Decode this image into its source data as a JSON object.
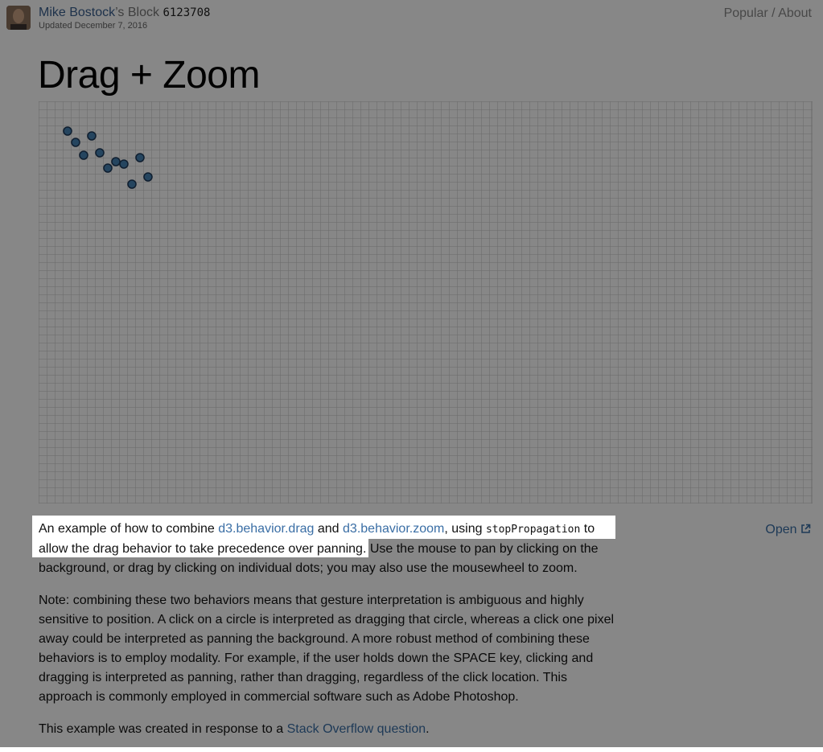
{
  "header": {
    "author": "Mike Bostock",
    "author_suffix": "’s Block",
    "block_id": "6123708",
    "updated": "Updated December 7, 2016",
    "nav": {
      "popular": "Popular",
      "separator": "/",
      "about": "About"
    }
  },
  "title": "Drag + Zoom",
  "open_label": "Open",
  "colors": {
    "dot_fill": "#4682b4",
    "link": "#3a6ea5",
    "overlay": "rgba(0,0,0,0.47)"
  },
  "desc": {
    "p1": {
      "t1": "An example of how to combine ",
      "link1": "d3.behavior.drag",
      "t2": " and ",
      "link2": "d3.behavior.zoom",
      "t3": ", using ",
      "code": "stopPropagation",
      "t4": " to allow the drag behavior to take precedence over panning.",
      "t5": " Use the mouse to pan by clicking on the background, or drag by clicking on individual dots; you may also use the mousewheel to zoom."
    },
    "p2": "Note: combining these two behaviors means that gesture interpretation is ambiguous and highly sensitive to position. A click on a circle is interpreted as dragging that circle, whereas a click one pixel away could be interpreted as panning the background. A more robust method of combining these behaviors is to employ modality. For example, if the user holds down the SPACE key, clicking and dragging is interpreted as panning, rather than dragging, regardless of the click location. This approach is commonly employed in commercial software such as Adobe Photoshop.",
    "p3": {
      "t1": "This example was created in response to a ",
      "link": "Stack Overflow question",
      "t2": "."
    }
  }
}
